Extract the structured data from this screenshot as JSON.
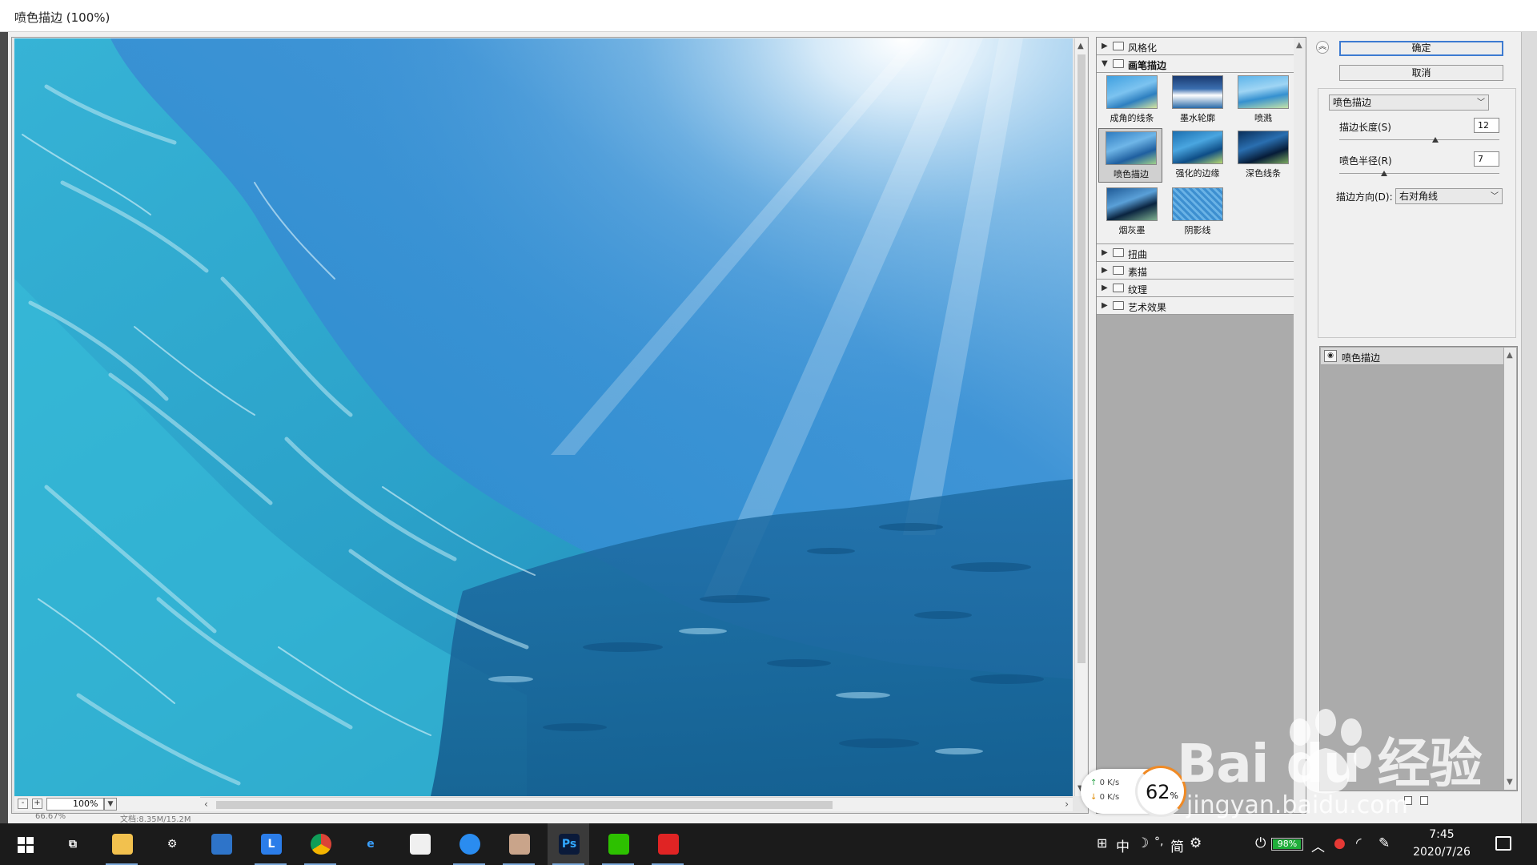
{
  "window": {
    "title": "喷色描边 (100%)"
  },
  "preview": {
    "zoom": "100%",
    "zoom_minus": "-",
    "zoom_plus": "+",
    "status_left": "66.67%",
    "status_right": "文档:8.35M/15.2M"
  },
  "gallery": {
    "categories_top": [
      {
        "label": "风格化",
        "open": false
      },
      {
        "label": "画笔描边",
        "open": true
      }
    ],
    "thumbs": [
      {
        "label": "成角的线条",
        "selected": false
      },
      {
        "label": "墨水轮廓",
        "selected": false
      },
      {
        "label": "喷溅",
        "selected": false
      },
      {
        "label": "喷色描边",
        "selected": true
      },
      {
        "label": "强化的边缘",
        "selected": false
      },
      {
        "label": "深色线条",
        "selected": false
      },
      {
        "label": "烟灰墨",
        "selected": false
      },
      {
        "label": "阴影线",
        "selected": false
      }
    ],
    "categories_bottom": [
      {
        "label": "扭曲"
      },
      {
        "label": "素描"
      },
      {
        "label": "纹理"
      },
      {
        "label": "艺术效果"
      }
    ]
  },
  "settings": {
    "ok_label": "确定",
    "cancel_label": "取消",
    "filter_select": "喷色描边",
    "stroke_length_label": "描边长度(S)",
    "stroke_length_value": "12",
    "stroke_length_fraction": 0.6,
    "spray_radius_label": "喷色半径(R)",
    "spray_radius_value": "7",
    "spray_radius_fraction": 0.28,
    "direction_label": "描边方向(D):",
    "direction_value": "右对角线"
  },
  "layers": {
    "items": [
      {
        "label": "喷色描边"
      }
    ]
  },
  "network": {
    "up": "0 K/s",
    "down": "0 K/s",
    "percent": "62",
    "percent_unit": "%"
  },
  "watermark": {
    "brand": "Bai du 经验",
    "url": "jingyan.baidu.com"
  },
  "taskbar": {
    "apps": [
      {
        "name": "task-view-icon",
        "glyph": "⧉"
      },
      {
        "name": "file-explorer-icon",
        "glyph": ""
      },
      {
        "name": "settings-gear-icon",
        "glyph": "⚙"
      },
      {
        "name": "photos-icon",
        "glyph": ""
      },
      {
        "name": "app-l-icon",
        "glyph": "L"
      },
      {
        "name": "chrome-icon",
        "glyph": ""
      },
      {
        "name": "edge-ie-icon",
        "glyph": "e"
      },
      {
        "name": "store-icon",
        "glyph": ""
      },
      {
        "name": "search-app-icon",
        "glyph": ""
      },
      {
        "name": "avatar-app-icon",
        "glyph": ""
      },
      {
        "name": "photoshop-icon",
        "glyph": "Ps"
      },
      {
        "name": "wechat-icon",
        "glyph": ""
      },
      {
        "name": "netease-music-icon",
        "glyph": ""
      }
    ],
    "ime": "中",
    "ime_mode": "简",
    "battery": "98%",
    "battery_fraction": 0.98,
    "time": "7:45",
    "date": "2020/7/26"
  }
}
